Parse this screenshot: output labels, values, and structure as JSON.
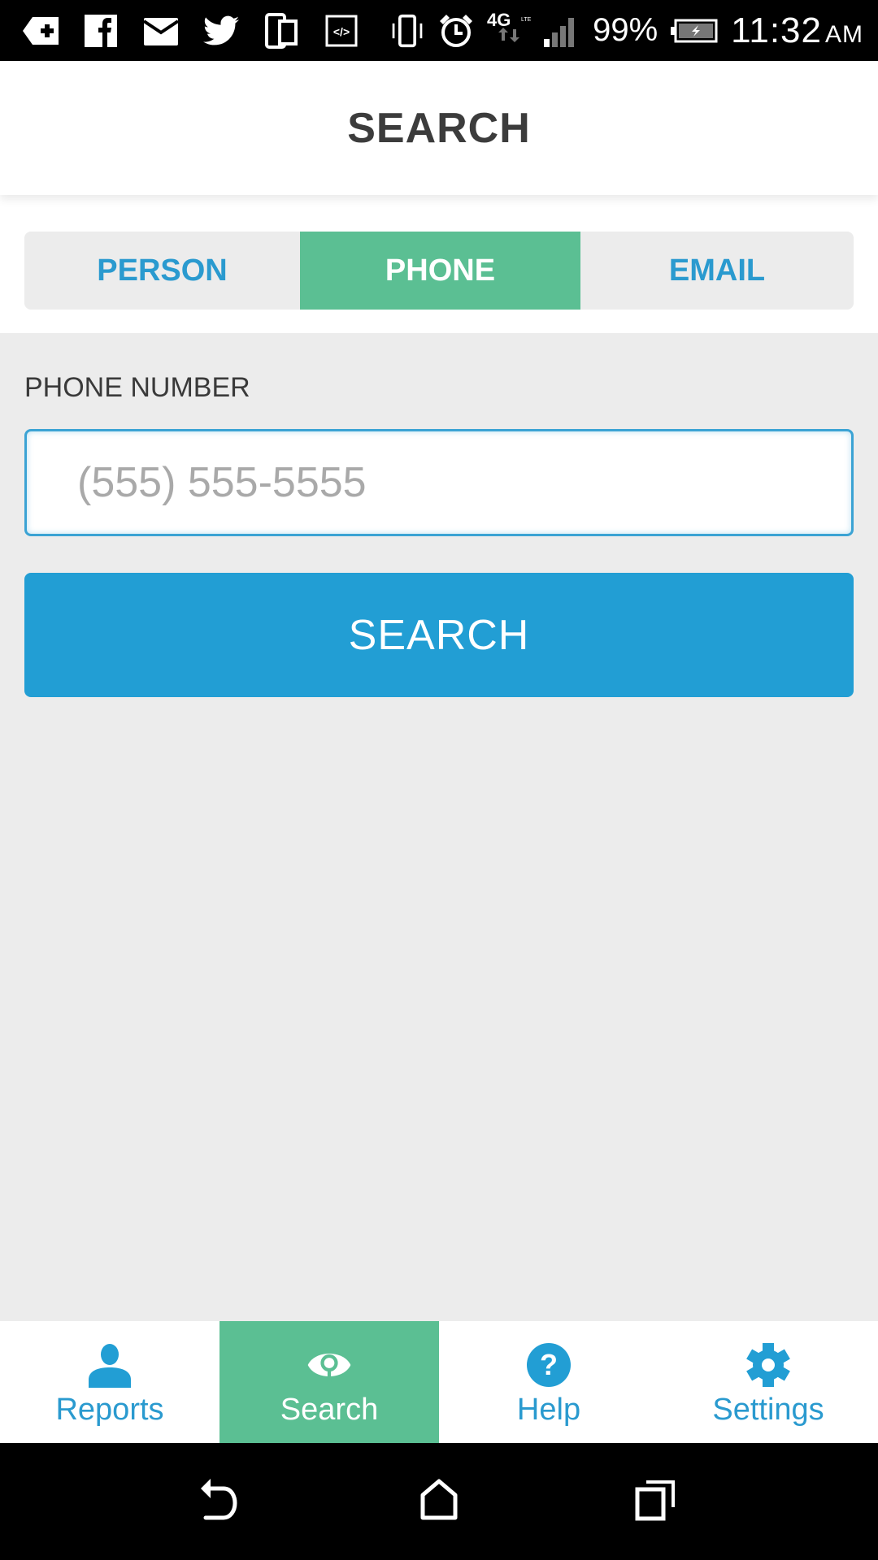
{
  "status_bar": {
    "notification_icons": [
      "add-tag-icon",
      "facebook-icon",
      "mail-icon",
      "twitter-icon",
      "devices-icon",
      "code-icon"
    ],
    "system_icons": [
      "vibrate-icon",
      "alarm-icon",
      "4g-lte-icon",
      "signal-icon"
    ],
    "battery_percent": "99%",
    "time": "11:32",
    "ampm": "AM"
  },
  "header": {
    "title": "SEARCH"
  },
  "segments": {
    "tabs": [
      {
        "label": "PERSON",
        "active": false
      },
      {
        "label": "PHONE",
        "active": true
      },
      {
        "label": "EMAIL",
        "active": false
      }
    ]
  },
  "form": {
    "label": "PHONE NUMBER",
    "input_value": "",
    "input_placeholder": "(555) 555-5555",
    "button_label": "SEARCH"
  },
  "tab_bar": {
    "items": [
      {
        "label": "Reports",
        "icon": "person-icon",
        "active": false
      },
      {
        "label": "Search",
        "icon": "eye-search-icon",
        "active": true
      },
      {
        "label": "Help",
        "icon": "help-icon",
        "active": false
      },
      {
        "label": "Settings",
        "icon": "gear-icon",
        "active": false
      }
    ]
  },
  "colors": {
    "accent_blue": "#229ed4",
    "accent_green": "#5bbf93",
    "background": "#ececec",
    "title_text": "#3c3c3c"
  },
  "nav_bar": {
    "buttons": [
      "back",
      "home",
      "recents"
    ]
  }
}
